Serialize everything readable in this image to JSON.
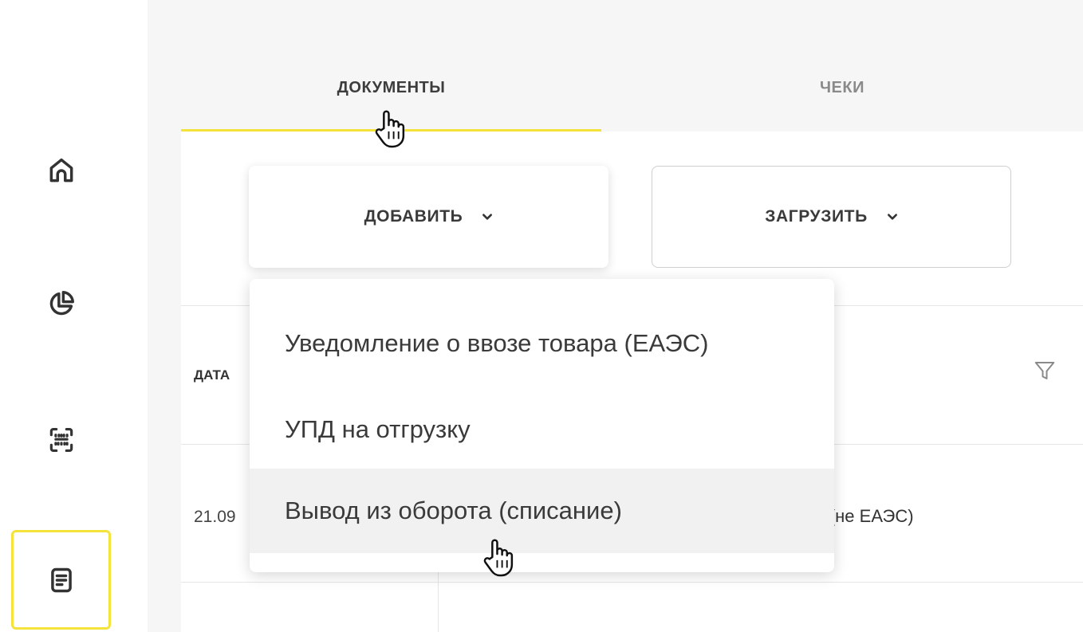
{
  "sidebar": {
    "items": [
      {
        "icon": "home-icon",
        "active": false
      },
      {
        "icon": "pie-chart-icon",
        "active": false
      },
      {
        "icon": "scan-code-icon",
        "active": false
      },
      {
        "icon": "document-icon",
        "active": true
      }
    ],
    "accent": "#f3e33a"
  },
  "tabs": [
    {
      "label": "ДОКУМЕНТЫ",
      "active": true
    },
    {
      "label": "ЧЕКИ",
      "active": false
    }
  ],
  "toolbar": {
    "add_label": "ДОБАВИТЬ",
    "upload_label": "ЗАГРУЗИТЬ"
  },
  "table": {
    "columns": [
      "ДАТА"
    ],
    "rows": [
      {
        "date": "21.09",
        "type": "ара (не ЕАЭС)"
      }
    ]
  },
  "dropdown": {
    "items": [
      "Уведомление о ввозе товара (ЕАЭС)",
      "УПД на отгрузку",
      "Вывод из оборота (списание)"
    ],
    "hovered_index": 2
  }
}
